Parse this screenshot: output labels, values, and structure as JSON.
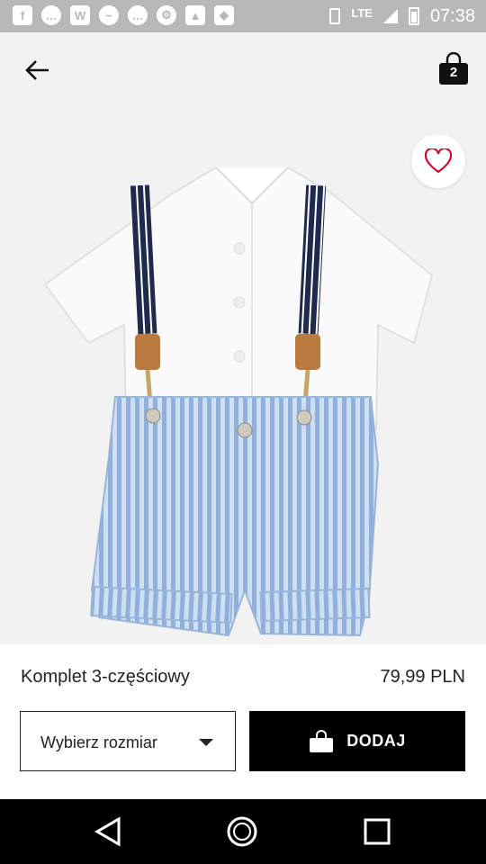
{
  "status_bar": {
    "time": "07:38",
    "network": "LTE",
    "notification_icons": [
      "facebook-icon",
      "messenger-icon",
      "vk-icon",
      "messenger-icon",
      "messenger-icon",
      "app-icon",
      "gallery-icon",
      "tag-icon"
    ]
  },
  "header": {
    "back_icon": "arrow-left-icon",
    "cart_count": "2"
  },
  "product": {
    "name": "Komplet 3-częściowy",
    "price": "79,99 PLN"
  },
  "actions": {
    "size_placeholder": "Wybierz rozmiar",
    "add_label": "DODAJ"
  },
  "colors": {
    "accent": "#000000",
    "background": "#f2f2f2",
    "favorite": "#c8102e"
  }
}
